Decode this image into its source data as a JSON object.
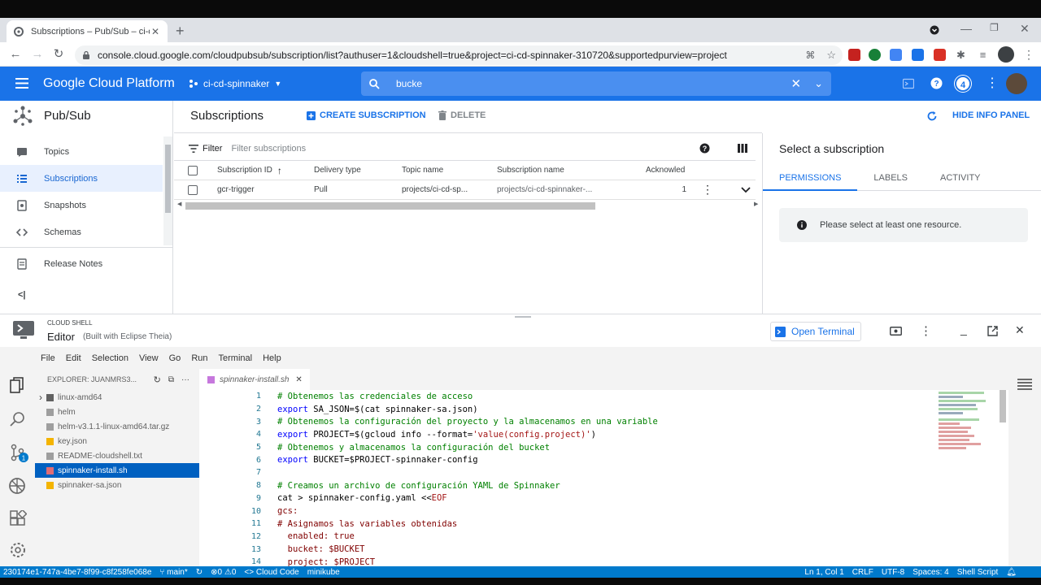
{
  "browser": {
    "tab_title": "Subscriptions – Pub/Sub – ci-cd-",
    "url": "console.cloud.google.com/cloudpubsub/subscription/list?authuser=1&cloudshell=true&project=ci-cd-spinnaker-310720&supportedpurview=project"
  },
  "gcp": {
    "brand": "Google Cloud Platform",
    "project": "ci-cd-spinnaker",
    "search_query": "bucke",
    "notif_count": "4"
  },
  "leftnav": {
    "title": "Pub/Sub",
    "items": [
      {
        "label": "Topics",
        "icon": "topics-icon"
      },
      {
        "label": "Subscriptions",
        "icon": "list-icon"
      },
      {
        "label": "Snapshots",
        "icon": "snapshot-icon"
      },
      {
        "label": "Schemas",
        "icon": "schema-icon"
      }
    ],
    "release_notes": "Release Notes",
    "collapse": "<|"
  },
  "main": {
    "title": "Subscriptions",
    "create_label": "CREATE SUBSCRIPTION",
    "delete_label": "DELETE",
    "filter_label": "Filter",
    "filter_placeholder": "Filter subscriptions",
    "columns": [
      "Subscription ID",
      "Delivery type",
      "Topic name",
      "Subscription name",
      "Acknowled"
    ],
    "rows": [
      {
        "id": "gcr-trigger",
        "delivery": "Pull",
        "topic": "projects/ci-cd-sp...",
        "name": "projects/ci-cd-spinnaker-...",
        "ack": "1"
      }
    ]
  },
  "infopanel": {
    "hide_label": "HIDE INFO PANEL",
    "title": "Select a subscription",
    "tabs": [
      "PERMISSIONS",
      "LABELS",
      "ACTIVITY"
    ],
    "notice": "Please select at least one resource."
  },
  "shell": {
    "small_label": "CLOUD SHELL",
    "title": "Editor",
    "subtitle": "(Built with Eclipse Theia)",
    "open_terminal": "Open Terminal",
    "menu": [
      "File",
      "Edit",
      "Selection",
      "View",
      "Go",
      "Run",
      "Terminal",
      "Help"
    ],
    "explorer_title": "EXPLORER: JUANMRS3...",
    "files": [
      {
        "name": "linux-amd64",
        "type": "folder",
        "color": "#616161"
      },
      {
        "name": "helm",
        "type": "file",
        "color": "#9e9e9e"
      },
      {
        "name": "helm-v3.1.1-linux-amd64.tar.gz",
        "type": "file",
        "color": "#9e9e9e"
      },
      {
        "name": "key.json",
        "type": "file",
        "color": "#f4b400"
      },
      {
        "name": "README-cloudshell.txt",
        "type": "file",
        "color": "#9e9e9e"
      },
      {
        "name": "spinnaker-install.sh",
        "type": "file",
        "color": "#c678dd"
      },
      {
        "name": "spinnaker-sa.json",
        "type": "file",
        "color": "#f4b400"
      }
    ],
    "editor_tab": "spinnaker-install.sh",
    "code": [
      {
        "n": "1",
        "parts": [
          {
            "t": "# Obtenemos las credenciales de acceso",
            "c": "c-comment"
          }
        ]
      },
      {
        "n": "2",
        "parts": [
          {
            "t": "export ",
            "c": "c-kw"
          },
          {
            "t": "SA_JSON=$(cat spinnaker-sa.json)",
            "c": "c-norm"
          }
        ]
      },
      {
        "n": "3",
        "parts": [
          {
            "t": "# Obtenemos la configuración del proyecto y la almacenamos en una variable",
            "c": "c-comment"
          }
        ]
      },
      {
        "n": "4",
        "parts": [
          {
            "t": "export ",
            "c": "c-kw"
          },
          {
            "t": "PROJECT=$(gcloud info --format=",
            "c": "c-norm"
          },
          {
            "t": "'value(config.project)'",
            "c": "c-red"
          },
          {
            "t": ")",
            "c": "c-norm"
          }
        ]
      },
      {
        "n": "5",
        "parts": [
          {
            "t": "# Obtenemos y almacenamos la configuración del bucket",
            "c": "c-comment"
          }
        ]
      },
      {
        "n": "6",
        "parts": [
          {
            "t": "export ",
            "c": "c-kw"
          },
          {
            "t": "BUCKET=$PROJECT-spinnaker-config",
            "c": "c-norm"
          }
        ]
      },
      {
        "n": "7",
        "parts": [
          {
            "t": "",
            "c": "c-norm"
          }
        ]
      },
      {
        "n": "8",
        "parts": [
          {
            "t": "# Creamos un archivo de configuración YAML de Spinnaker",
            "c": "c-comment"
          }
        ]
      },
      {
        "n": "9",
        "parts": [
          {
            "t": "cat > spinnaker-config.yaml <<",
            "c": "c-norm"
          },
          {
            "t": "EOF",
            "c": "c-red"
          }
        ]
      },
      {
        "n": "10",
        "parts": [
          {
            "t": "gcs:",
            "c": "c-yaml"
          }
        ]
      },
      {
        "n": "11",
        "parts": [
          {
            "t": "# Asignamos las variables obtenidas",
            "c": "c-yaml"
          }
        ]
      },
      {
        "n": "12",
        "parts": [
          {
            "t": "  enabled: true",
            "c": "c-yaml"
          }
        ]
      },
      {
        "n": "13",
        "parts": [
          {
            "t": "  bucket: $BUCKET",
            "c": "c-yaml"
          }
        ]
      },
      {
        "n": "14",
        "parts": [
          {
            "t": "  project: $PROJECT",
            "c": "c-yaml"
          }
        ]
      }
    ],
    "status_left": [
      "230174e1-747a-4be7-8f99-c8f258fe068e",
      "main*",
      "0",
      "0",
      "Cloud Code",
      "minikube"
    ],
    "status_right": [
      "Ln 1, Col 1",
      "CRLF",
      "UTF-8",
      "Spaces: 4",
      "Shell Script"
    ]
  }
}
